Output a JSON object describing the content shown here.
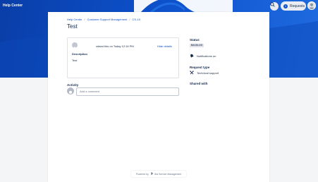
{
  "header": {
    "title": "Help Center",
    "requests_label": "Requests",
    "requests_count": "1",
    "search_icon": "search-icon",
    "avatar_icon": "user-avatar-icon"
  },
  "breadcrumb": {
    "items": [
      "Help Center",
      "Customer Support Management",
      "CS-15"
    ],
    "separator": "/"
  },
  "request": {
    "title": "Test",
    "raised_text": "raised this on Today 12:16 PM",
    "hide_details_label": "Hide details",
    "description_label": "Description",
    "description_value": "Test"
  },
  "activity": {
    "label": "Activity",
    "comment_placeholder": "Add a comment"
  },
  "sidebar": {
    "status_label": "Status",
    "status_value": "BACKLOG",
    "notifications_label": "Notifications on",
    "request_type_label": "Request type",
    "request_type_value": "Technical support",
    "shared_with_label": "Shared with"
  },
  "footer": {
    "powered_by": "Powered by",
    "product": "Jira Service Management"
  },
  "colors": {
    "brand": "#0c4fc9",
    "hero_dark": "#0a3ea8",
    "background": "#f4f5f7"
  }
}
